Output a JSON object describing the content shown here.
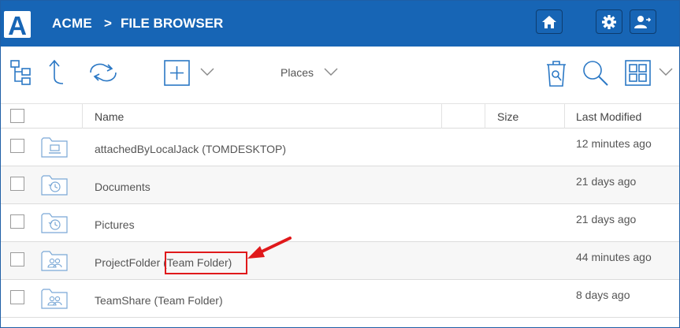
{
  "header": {
    "logo_letter": "A",
    "brand": "ACME",
    "separator": ">",
    "location": "FILE BROWSER"
  },
  "toolbar": {
    "places_label": "Places"
  },
  "table": {
    "columns": [
      "Name",
      "Size",
      "Last Modified"
    ],
    "rows": [
      {
        "name": "attachedByLocalJack (TOMDESKTOP)",
        "modified": "12 minutes ago",
        "icon": "drive-folder-icon"
      },
      {
        "name": "Documents",
        "modified": "21 days ago",
        "icon": "history-folder-icon"
      },
      {
        "name": "Pictures",
        "modified": "21 days ago",
        "icon": "history-folder-icon"
      },
      {
        "name": "ProjectFolder (Team Folder)",
        "modified": "44 minutes ago",
        "icon": "team-folder-icon"
      },
      {
        "name": "TeamShare (Team Folder)",
        "modified": "8 days ago",
        "icon": "team-folder-icon"
      }
    ]
  },
  "colors": {
    "header_bg": "#1765b5",
    "icon_blue": "#2b78c5",
    "annotation_red": "#e0191b"
  }
}
